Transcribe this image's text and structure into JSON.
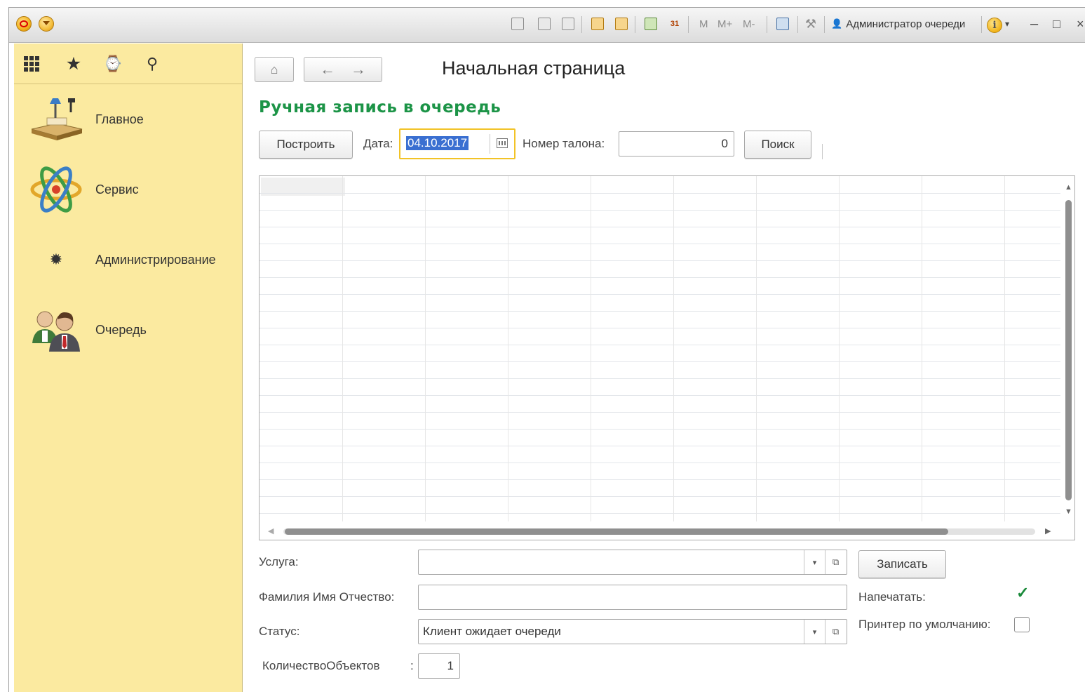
{
  "titlebar": {
    "user_name": "Администратор очереди",
    "memory_buttons": [
      "M",
      "M+",
      "M-"
    ],
    "calendar_day": "31"
  },
  "sidebar": {
    "items": [
      {
        "label": "Главное",
        "icon": "desk-lamp-icon"
      },
      {
        "label": "Сервис",
        "icon": "atom-icon"
      },
      {
        "label": "Администрирование",
        "icon": "gear-icon"
      },
      {
        "label": "Очередь",
        "icon": "people-icon"
      }
    ]
  },
  "main": {
    "page_title": "Начальная страница",
    "form_title": "Ручная запись в очередь",
    "build_button": "Построить",
    "date_label": "Дата:",
    "date_value": "04.10.2017",
    "ticket_label": "Номер талона:",
    "ticket_value": "0",
    "search_button": "Поиск",
    "service_label": "Услуга:",
    "service_value": "",
    "fio_label": "Фамилия Имя Отчество:",
    "fio_value": "",
    "status_label": "Статус:",
    "status_value": "Клиент ожидает очереди",
    "count_label": "КоличествоОбъектов",
    "count_colon": ":",
    "count_value": "1",
    "record_button": "Записать",
    "print_label": "Напечатать:",
    "print_checked": true,
    "default_printer_label": "Принтер по умолчанию:",
    "default_printer_checked": false
  },
  "colors": {
    "sidebar_bg": "#fbeaa0",
    "form_title": "#1c9447",
    "date_highlight": "#3a6fd1",
    "focus_border": "#f2c327"
  }
}
